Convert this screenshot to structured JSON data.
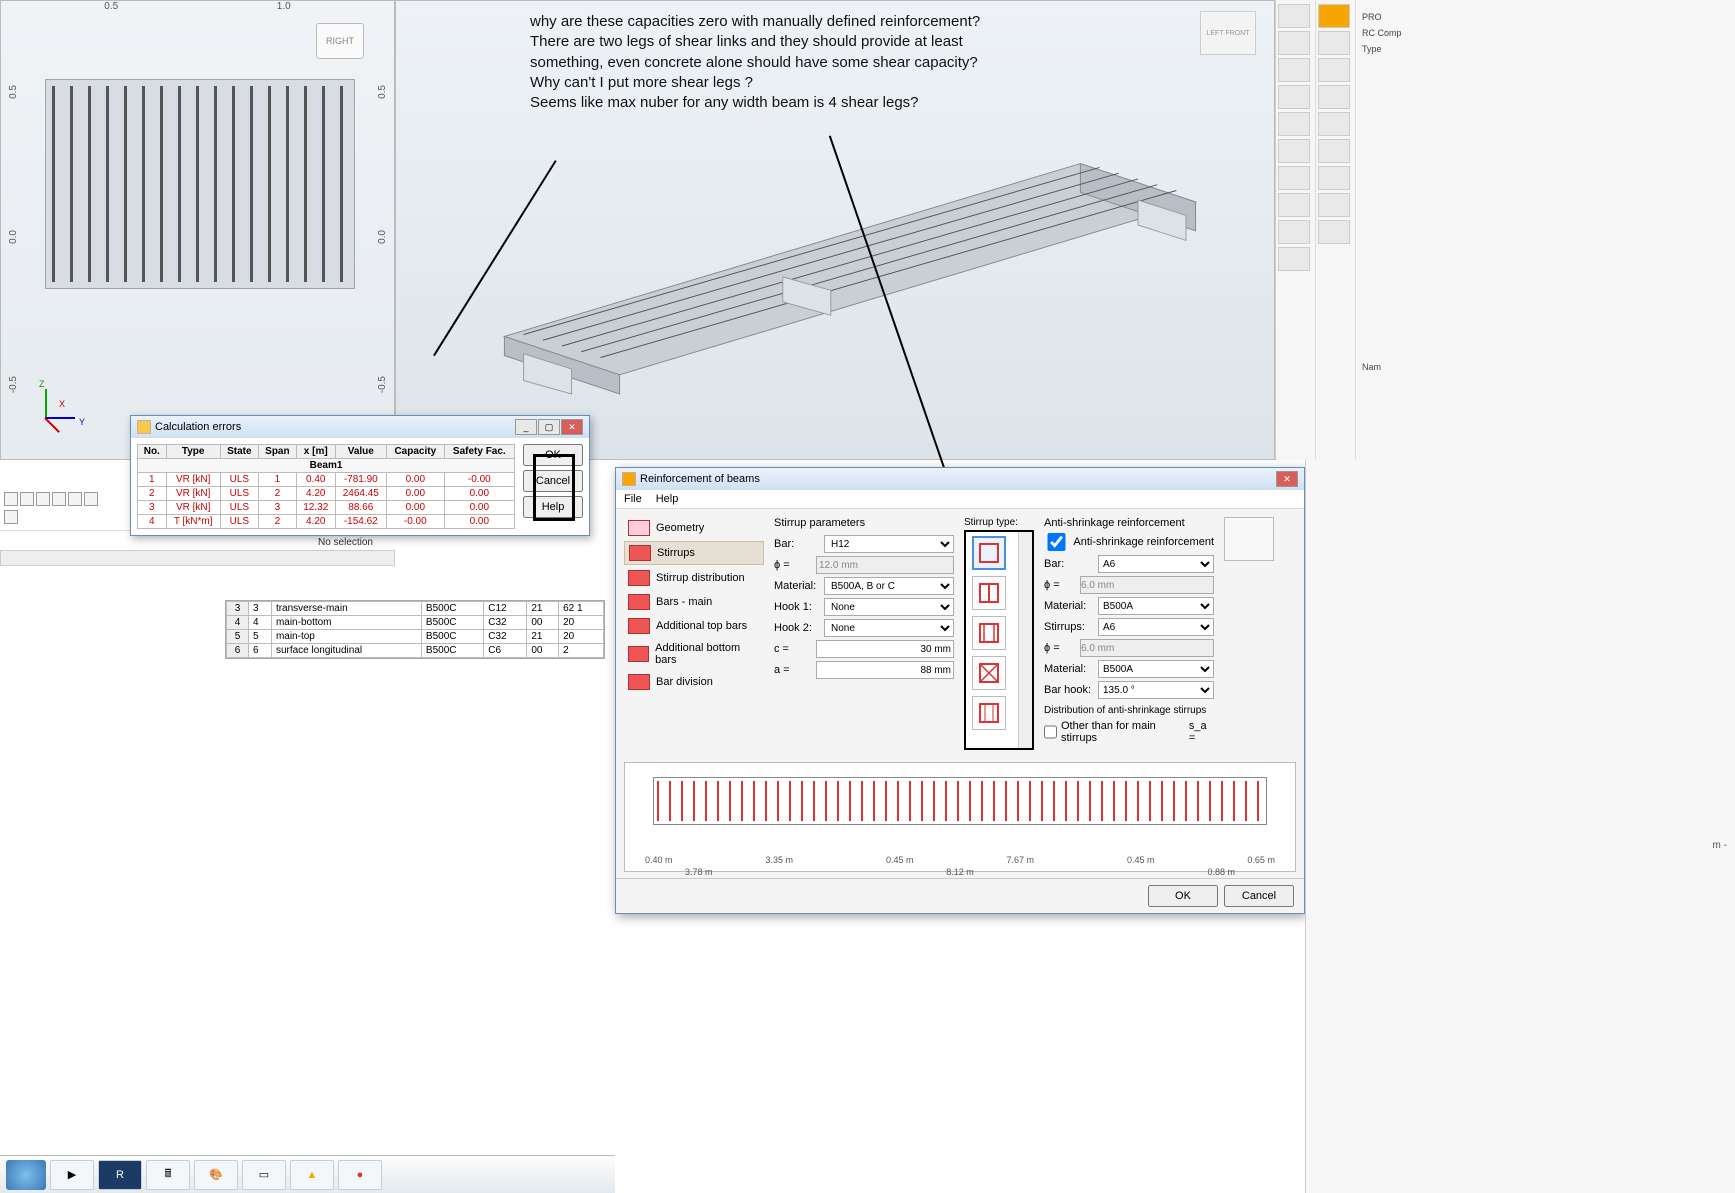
{
  "viewport_tl": {
    "ruler_top": [
      "0.5",
      "1.0"
    ],
    "ruler_side": [
      "-0.5",
      "0.0",
      "0.5"
    ],
    "right_button": "RIGHT",
    "axes": {
      "x": "X",
      "y": "Y",
      "z": "Z"
    }
  },
  "viewport_main": {
    "viewcube": "LEFT FRONT"
  },
  "annotation": {
    "text": "why are these capacities zero with manually defined reinforcement? There are two legs of shear links and they should provide at least something, even concrete alone should have some shear capacity?\nWhy can't I put more shear legs ?\nSeems like max nuber for any width beam is 4 shear legs?"
  },
  "bottom_left": {
    "no_selection": "No selection"
  },
  "grid_bottom": {
    "rows": [
      {
        "n": "3",
        "n2": "3",
        "desc": "transverse-main",
        "grade": "B500C",
        "cls": "C12",
        "d": "21",
        "val": "62 1"
      },
      {
        "n": "4",
        "n2": "4",
        "desc": "main-bottom",
        "grade": "B500C",
        "cls": "C32",
        "d": "00",
        "val": "20"
      },
      {
        "n": "5",
        "n2": "5",
        "desc": "main-top",
        "grade": "B500C",
        "cls": "C32",
        "d": "21",
        "val": "20"
      },
      {
        "n": "6",
        "n2": "6",
        "desc": "surface longitudinal",
        "grade": "B500C",
        "cls": "C6",
        "d": "00",
        "val": "2"
      }
    ]
  },
  "dlg_errors": {
    "title": "Calculation errors",
    "headers": [
      "No.",
      "Type",
      "State",
      "Span",
      "x [m]",
      "Value",
      "Capacity",
      "Safety Fac."
    ],
    "beam_label": "Beam1",
    "rows": [
      {
        "no": "1",
        "type": "VR [kN]",
        "state": "ULS",
        "span": "1",
        "x": "0.40",
        "value": "-781.90",
        "cap": "0.00",
        "sf": "-0.00"
      },
      {
        "no": "2",
        "type": "VR [kN]",
        "state": "ULS",
        "span": "2",
        "x": "4.20",
        "value": "2464.45",
        "cap": "0.00",
        "sf": "0.00"
      },
      {
        "no": "3",
        "type": "VR [kN]",
        "state": "ULS",
        "span": "3",
        "x": "12.32",
        "value": "88.66",
        "cap": "0.00",
        "sf": "0.00"
      },
      {
        "no": "4",
        "type": "T [kN*m]",
        "state": "ULS",
        "span": "2",
        "x": "4.20",
        "value": "-154.62",
        "cap": "-0.00",
        "sf": "0.00"
      }
    ],
    "buttons": {
      "ok": "OK",
      "cancel": "Cancel",
      "help": "Help"
    }
  },
  "dlg_reinf": {
    "title": "Reinforcement of beams",
    "menu": [
      "File",
      "Help"
    ],
    "nav": [
      "Geometry",
      "Stirrups",
      "Stirrup distribution",
      "Bars - main",
      "Additional top bars",
      "Additional bottom bars",
      "Bar division"
    ],
    "nav_selected": 1,
    "stirrup_params": {
      "header": "Stirrup parameters",
      "bar_label": "Bar:",
      "bar": "H12",
      "phi_label": "ϕ =",
      "phi": "12.0 mm",
      "material_label": "Material:",
      "material": "B500A, B or C",
      "hook1_label": "Hook 1:",
      "hook1": "None",
      "hook2_label": "Hook 2:",
      "hook2": "None",
      "c_label": "c =",
      "c": "30 mm",
      "a_label": "a =",
      "a": "88 mm"
    },
    "stirrup_type": {
      "header": "Stirrup type:"
    },
    "anti": {
      "header": "Anti-shrinkage reinforcement",
      "chk_label": "Anti-shrinkage reinforcement",
      "bar_label": "Bar:",
      "bar": "A6",
      "phi_label": "ϕ =",
      "phi": "6.0 mm",
      "material_label": "Material:",
      "material": "B500A",
      "stirrups_label": "Stirrups:",
      "stirrups": "A6",
      "phi2": "6.0 mm",
      "material2_label": "Material:",
      "material2": "B500A",
      "barhook_label": "Bar hook:",
      "barhook": "135.0 °",
      "dist_label": "Distribution of anti-shrinkage stirrups",
      "other_label": "Other than for main stirrups",
      "sa": "s_a ="
    },
    "elev_dims": [
      "0.40 m",
      "3.35 m",
      "0.45 m",
      "7.67 m",
      "0.45 m",
      "0.65 m",
      "3.78 m",
      "8.12 m",
      "0.88 m"
    ],
    "footer": {
      "ok": "OK",
      "cancel": "Cancel"
    }
  },
  "right_strip": {
    "badge": "PRO",
    "panel": "RC Comp",
    "type_label": "Type",
    "name_label": "Nam"
  },
  "br_panel": {
    "m": "m -"
  }
}
